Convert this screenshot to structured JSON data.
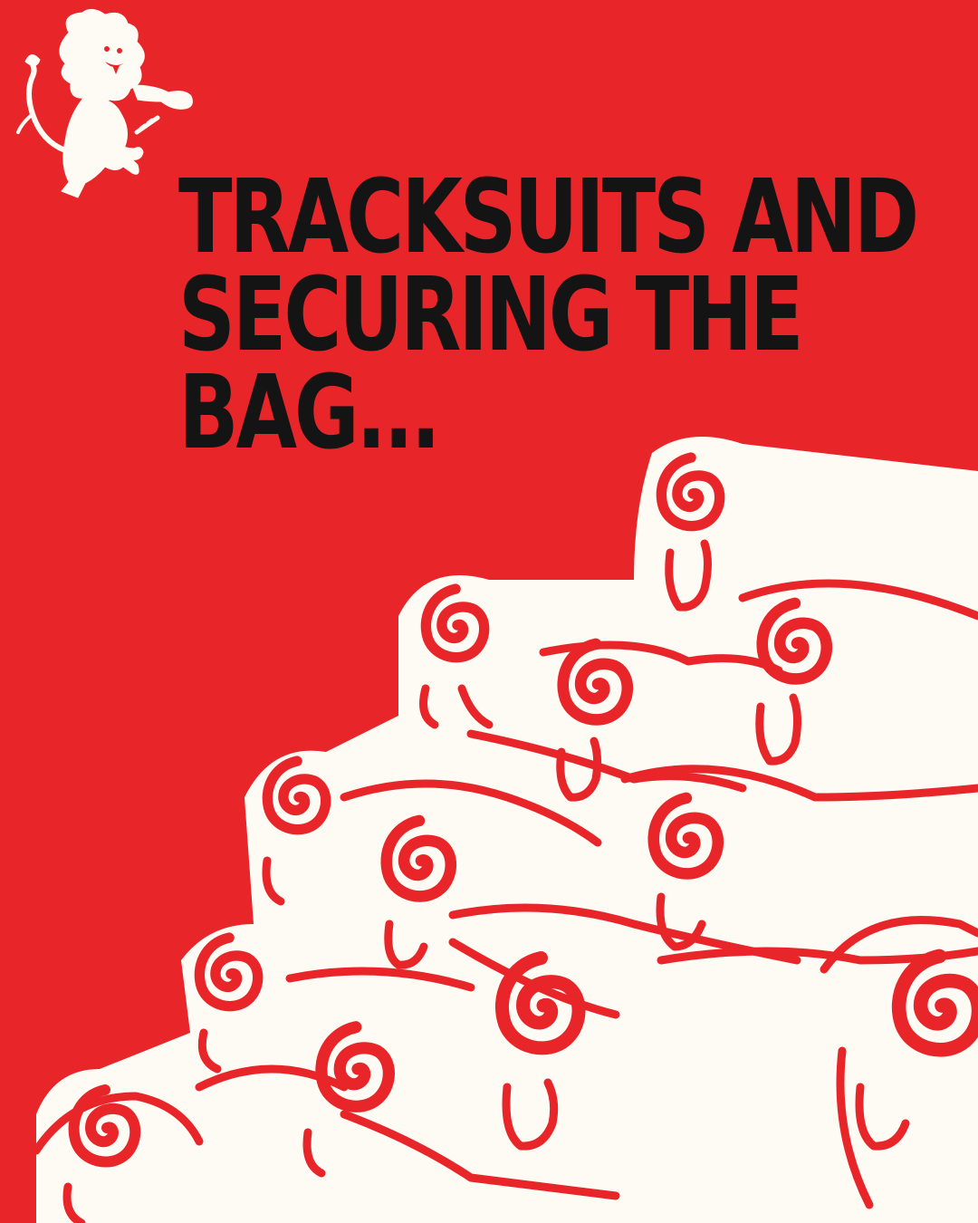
{
  "poster": {
    "background_color": "#e8262a",
    "headline_color": "#141414",
    "illustration_color": "#fdfbf4",
    "logo_icon": "rampant-lion-icon",
    "headline_lines": [
      "TRACKSUITS AND",
      "SECURING THE",
      "BAG..."
    ],
    "illustration": "flock-of-sheep-illustration"
  }
}
